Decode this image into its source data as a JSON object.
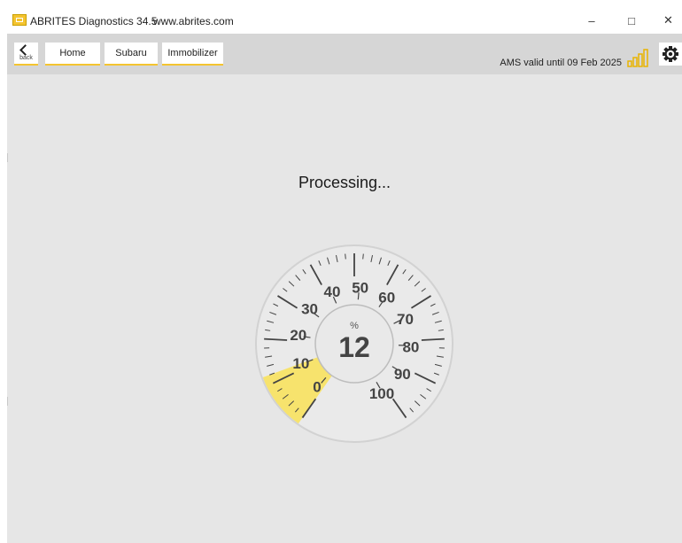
{
  "window": {
    "title": "ABRITES Diagnostics 34.5",
    "url": "www.abrites.com",
    "minimize_glyph": "–",
    "maximize_glyph": "□",
    "close_glyph": "✕"
  },
  "toolbar": {
    "back_label": "back",
    "breadcrumbs": [
      "Home",
      "Subaru",
      "Immobilizer"
    ],
    "license_text": "AMS valid until 09 Feb 2025",
    "icons": [
      "back-chevron-icon",
      "signal-bars-icon",
      "gear-icon"
    ]
  },
  "main": {
    "status_text": "Processing...",
    "gauge": {
      "unit": "%",
      "value_text": "12",
      "value": 12,
      "min": 0,
      "max": 100,
      "tick_labels": [
        "0",
        "10",
        "20",
        "30",
        "40",
        "50",
        "60",
        "70",
        "80",
        "90",
        "100"
      ],
      "fill_color": "#f7e36d",
      "tick_color": "#444444"
    }
  }
}
